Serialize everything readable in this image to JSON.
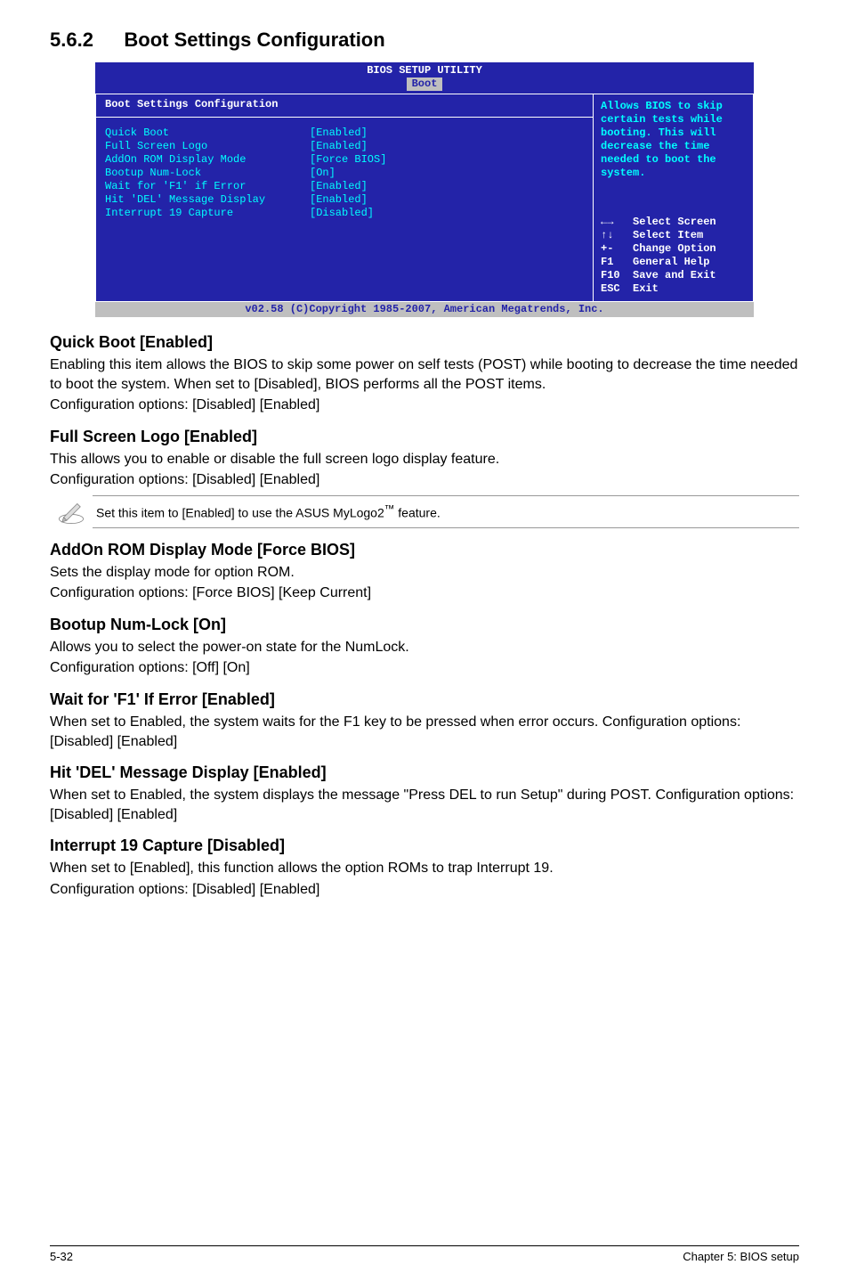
{
  "section": {
    "num": "5.6.2",
    "title": "Boot Settings Configuration"
  },
  "bios": {
    "top": "BIOS SETUP UTILITY",
    "tab": "Boot",
    "leftTitle": "Boot Settings Configuration",
    "rows": [
      {
        "k": "Quick Boot",
        "v": "[Enabled]"
      },
      {
        "k": "Full Screen Logo",
        "v": "[Enabled]"
      },
      {
        "k": "AddOn ROM Display Mode",
        "v": "[Force BIOS]"
      },
      {
        "k": "Bootup Num-Lock",
        "v": "[On]"
      },
      {
        "k": "Wait for 'F1' if Error",
        "v": "[Enabled]"
      },
      {
        "k": "Hit 'DEL' Message Display",
        "v": "[Enabled]"
      },
      {
        "k": "Interrupt 19 Capture",
        "v": "[Disabled]"
      }
    ],
    "help": "Allows BIOS to skip certain tests while booting. This will decrease the time needed to boot the system.",
    "nav": [
      {
        "sym": "←→",
        "txt": "Select Screen"
      },
      {
        "sym": "↑↓",
        "txt": "Select Item"
      },
      {
        "sym": "+-",
        "txt": "Change Option"
      },
      {
        "sym": "F1",
        "txt": "General Help"
      },
      {
        "sym": "F10",
        "txt": "Save and Exit"
      },
      {
        "sym": "ESC",
        "txt": "Exit"
      }
    ],
    "footer": "v02.58 (C)Copyright 1985-2007, American Megatrends, Inc."
  },
  "blocks": {
    "quickBoot": {
      "h": "Quick Boot [Enabled]",
      "p1": "Enabling this item allows the BIOS to skip some power on self tests (POST) while booting to decrease the time needed to boot the system. When set to [Disabled], BIOS performs all the POST items.",
      "p2": "Configuration options: [Disabled] [Enabled]"
    },
    "fullScreen": {
      "h": "Full Screen Logo [Enabled]",
      "p1": "This allows you to enable or disable the full screen logo display feature.",
      "p2": "Configuration options: [Disabled] [Enabled]"
    },
    "note": {
      "pre": "Set this item to [Enabled] to use the ASUS MyLogo2",
      "sup": "™",
      "post": " feature."
    },
    "addon": {
      "h": "AddOn ROM Display Mode [Force BIOS]",
      "p1": "Sets the display mode for option ROM.",
      "p2": "Configuration options: [Force BIOS] [Keep Current]"
    },
    "numlock": {
      "h": "Bootup Num-Lock [On]",
      "p1": "Allows you to select the power-on state for the NumLock.",
      "p2": "Configuration options: [Off] [On]"
    },
    "waitf1": {
      "h": "Wait for 'F1' If Error [Enabled]",
      "p1": "When set to Enabled, the system waits for the F1 key to be pressed when error occurs. Configuration options: [Disabled] [Enabled]"
    },
    "hitdel": {
      "h": "Hit 'DEL' Message Display [Enabled]",
      "p1": "When set to Enabled, the system displays the message \"Press DEL to run Setup\" during POST. Configuration options: [Disabled] [Enabled]"
    },
    "int19": {
      "h": "Interrupt 19 Capture [Disabled]",
      "p1": "When set to [Enabled], this function allows the option ROMs to trap Interrupt 19.",
      "p2": "Configuration options: [Disabled] [Enabled]"
    }
  },
  "footer": {
    "left": "5-32",
    "right": "Chapter 5: BIOS setup"
  }
}
